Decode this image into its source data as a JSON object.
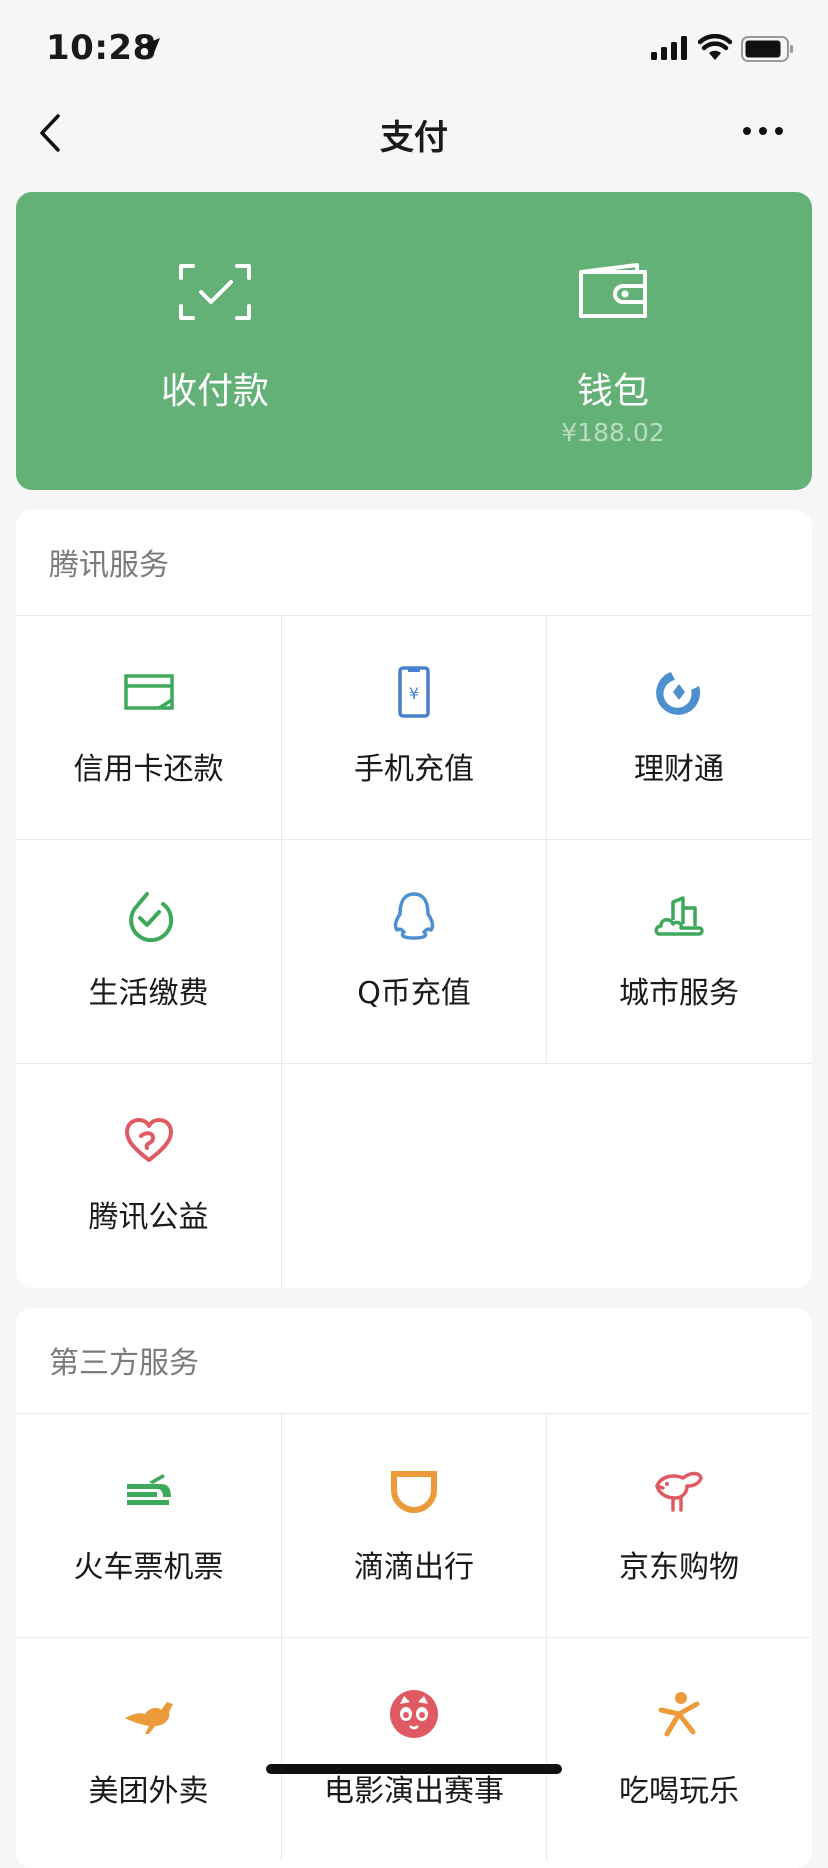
{
  "status_bar": {
    "time": "10:28"
  },
  "nav": {
    "title": "支付"
  },
  "hero": {
    "receive_label": "收付款",
    "wallet_label": "钱包",
    "wallet_balance": "¥188.02"
  },
  "tencent_services": {
    "title": "腾讯服务",
    "items": [
      {
        "label": "信用卡还款",
        "icon": "credit-card-icon",
        "color": "#3ea95b"
      },
      {
        "label": "手机充值",
        "icon": "phone-topup-icon",
        "color": "#4a7fc9"
      },
      {
        "label": "理财通",
        "icon": "wealth-icon",
        "color": "#4e8fd0"
      },
      {
        "label": "生活缴费",
        "icon": "utility-bill-icon",
        "color": "#3ea95b"
      },
      {
        "label": "Q币充值",
        "icon": "qq-penguin-icon",
        "color": "#4e8fd0"
      },
      {
        "label": "城市服务",
        "icon": "city-service-icon",
        "color": "#3ea95b"
      },
      {
        "label": "腾讯公益",
        "icon": "charity-heart-icon",
        "color": "#e05a63"
      }
    ]
  },
  "third_party_services": {
    "title": "第三方服务",
    "items": [
      {
        "label": "火车票机票",
        "icon": "train-ticket-icon",
        "color": "#3ea95b"
      },
      {
        "label": "滴滴出行",
        "icon": "didi-icon",
        "color": "#ec9a3a"
      },
      {
        "label": "京东购物",
        "icon": "jd-dog-icon",
        "color": "#e05a63"
      },
      {
        "label": "美团外卖",
        "icon": "kangaroo-icon",
        "color": "#ec9a3a"
      },
      {
        "label": "电影演出赛事",
        "icon": "movie-cat-icon",
        "color": "#e05a63"
      },
      {
        "label": "吃喝玩乐",
        "icon": "food-fun-icon",
        "color": "#ec9a3a"
      }
    ]
  }
}
